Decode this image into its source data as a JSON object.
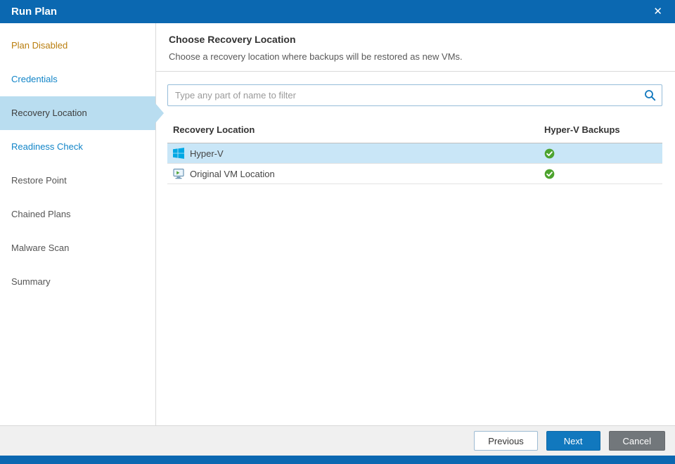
{
  "titlebar": {
    "title": "Run Plan",
    "close_glyph": "✕"
  },
  "sidebar": {
    "items": [
      {
        "label": "Plan Disabled",
        "state": "warning"
      },
      {
        "label": "Credentials",
        "state": "link"
      },
      {
        "label": "Recovery Location",
        "state": "active"
      },
      {
        "label": "Readiness Check",
        "state": "link"
      },
      {
        "label": "Restore Point",
        "state": "default"
      },
      {
        "label": "Chained Plans",
        "state": "default"
      },
      {
        "label": "Malware Scan",
        "state": "default"
      },
      {
        "label": "Summary",
        "state": "default"
      }
    ]
  },
  "main": {
    "heading": "Choose Recovery Location",
    "subheading": "Choose a recovery location where backups will be restored as new VMs.",
    "filter": {
      "placeholder": "Type any part of name to filter"
    },
    "table": {
      "columns": [
        "Recovery Location",
        "Hyper-V Backups"
      ],
      "rows": [
        {
          "name": "Hyper-V",
          "icon": "hyperv-icon",
          "backup_status": "ok",
          "selected": true
        },
        {
          "name": "Original VM Location",
          "icon": "vm-location-icon",
          "backup_status": "ok",
          "selected": false
        }
      ]
    }
  },
  "footer": {
    "previous_label": "Previous",
    "next_label": "Next",
    "cancel_label": "Cancel"
  },
  "colors": {
    "header_blue": "#0b68b1",
    "link_blue": "#1285c8",
    "warning_amber": "#b97d0d",
    "selection_blue": "#b9ddf0",
    "row_selection_blue": "#c9e6f7",
    "success_green": "#4ca32e",
    "next_button_blue": "#1178be",
    "cancel_gray": "#72777b",
    "hyperv_logo_blue": "#00a8e4"
  }
}
